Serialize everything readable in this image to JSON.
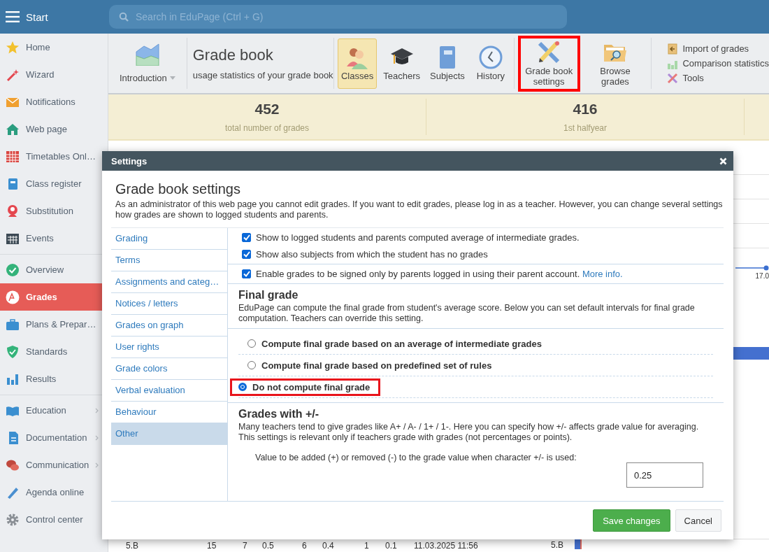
{
  "topbar": {
    "title": "Start",
    "search": {
      "placeholder": "Search in EduPage (Ctrl + G)"
    }
  },
  "sidebar": {
    "groups": [
      {
        "items": [
          {
            "label": "Home",
            "selected": false,
            "has_submenu": false
          },
          {
            "label": "Wizard",
            "selected": false,
            "has_submenu": false
          },
          {
            "label": "Notifications",
            "selected": false,
            "has_submenu": false
          },
          {
            "label": "Web page",
            "selected": false,
            "has_submenu": false
          },
          {
            "label": "Timetables Onl…",
            "selected": false,
            "has_submenu": false
          },
          {
            "label": "Class register",
            "selected": false,
            "has_submenu": false
          },
          {
            "label": "Substitution",
            "selected": false,
            "has_submenu": false
          },
          {
            "label": "Events",
            "selected": false,
            "has_submenu": false
          }
        ]
      },
      {
        "items": [
          {
            "label": "Overview",
            "selected": false,
            "has_submenu": false
          },
          {
            "label": "Grades",
            "selected": true,
            "has_submenu": false
          },
          {
            "label": "Plans & Prepar…",
            "selected": false,
            "has_submenu": false
          },
          {
            "label": "Standards",
            "selected": false,
            "has_submenu": false
          },
          {
            "label": "Results",
            "selected": false,
            "has_submenu": false
          }
        ]
      },
      {
        "items": [
          {
            "label": "Education",
            "selected": false,
            "has_submenu": true
          },
          {
            "label": "Documentation",
            "selected": false,
            "has_submenu": true
          },
          {
            "label": "Communication",
            "selected": false,
            "has_submenu": true
          },
          {
            "label": "Agenda online",
            "selected": false,
            "has_submenu": false
          },
          {
            "label": "Control center",
            "selected": false,
            "has_submenu": false
          }
        ]
      }
    ]
  },
  "ribbon": {
    "menu": {
      "label": "Introduction"
    },
    "title": "Grade book",
    "subtitle": "usage statistics of your grade book",
    "groups": [
      {
        "buttons": [
          {
            "label": "Classes",
            "selected": true,
            "highlighted": false
          },
          {
            "label": "Teachers",
            "selected": false,
            "highlighted": false
          },
          {
            "label": "Subjects",
            "selected": false,
            "highlighted": false
          },
          {
            "label": "History",
            "selected": false,
            "highlighted": false
          }
        ]
      },
      {
        "buttons": [
          {
            "label": "Grade book settings",
            "selected": false,
            "highlighted": true
          },
          {
            "label": "Browse grades",
            "selected": false,
            "highlighted": false
          }
        ]
      }
    ],
    "links": [
      {
        "label": "Import of grades"
      },
      {
        "label": "Comparison statistics"
      },
      {
        "label": "Tools"
      }
    ]
  },
  "stats": [
    {
      "value": "452",
      "label": "total number of grades"
    },
    {
      "value": "416",
      "label": "1st halfyear"
    }
  ],
  "background": {
    "chart_labels": [
      "17.0",
      "5.B"
    ],
    "row": [
      "5.B",
      "15",
      "7",
      "0.5",
      "6",
      "0.4",
      "1",
      "0.1",
      "11.03.2025 11:56"
    ]
  },
  "dialog": {
    "title": "Settings",
    "heading": "Grade book settings",
    "intro": "As an administrator of this web page you cannot edit grades. If you want to edit grades, please log in as a teacher. However, you can change several settings how grades are shown to logged students and parents.",
    "nav": [
      {
        "label": "Grading",
        "selected": false
      },
      {
        "label": "Terms",
        "selected": false
      },
      {
        "label": "Assignments and categ…",
        "selected": false
      },
      {
        "label": "Notices / letters",
        "selected": false
      },
      {
        "label": "Grades on graph",
        "selected": false
      },
      {
        "label": "User rights",
        "selected": false
      },
      {
        "label": "Grade colors",
        "selected": false
      },
      {
        "label": "Verbal evaluation",
        "selected": false
      },
      {
        "label": "Behaviour",
        "selected": false
      },
      {
        "label": "Other",
        "selected": true
      }
    ],
    "checkbox_groups": [
      {
        "items": [
          {
            "label": "Show to logged students and parents computed average of intermediate grades.",
            "checked": true
          },
          {
            "label": "Show also subjects from which the student has no grades",
            "checked": true
          }
        ]
      },
      {
        "items": [
          {
            "label": "Enable grades to be signed only by parents logged in using their parent account.",
            "link": "More info.",
            "checked": true
          }
        ]
      }
    ],
    "final_grade": {
      "heading": "Final grade",
      "description": "EduPage can compute the final grade from student's average score. Below you can set default intervals for final grade computation. Teachers can override this setting.",
      "options": [
        {
          "label": "Compute final grade based on an average of intermediate grades",
          "selected": false,
          "highlighted": false
        },
        {
          "label": "Compute final grade based on predefined set of rules",
          "selected": false,
          "highlighted": false
        },
        {
          "label": "Do not compute final grade",
          "selected": true,
          "highlighted": true
        }
      ]
    },
    "plus_minus": {
      "heading": "Grades with +/-",
      "description": "Many teachers tend to give grades like A+ / A- / 1+ / 1-. Here you can specify how +/- affects grade value for averaging. This settings is relevant only if teachers grade with grades (not percentages or points).",
      "field_label": "Value to be added (+) or removed (-) to the grade value when character +/- is used:",
      "value": "0.25"
    },
    "buttons": [
      {
        "label": "Save changes",
        "kind": "primary"
      },
      {
        "label": "Cancel",
        "kind": "secondary"
      }
    ]
  }
}
